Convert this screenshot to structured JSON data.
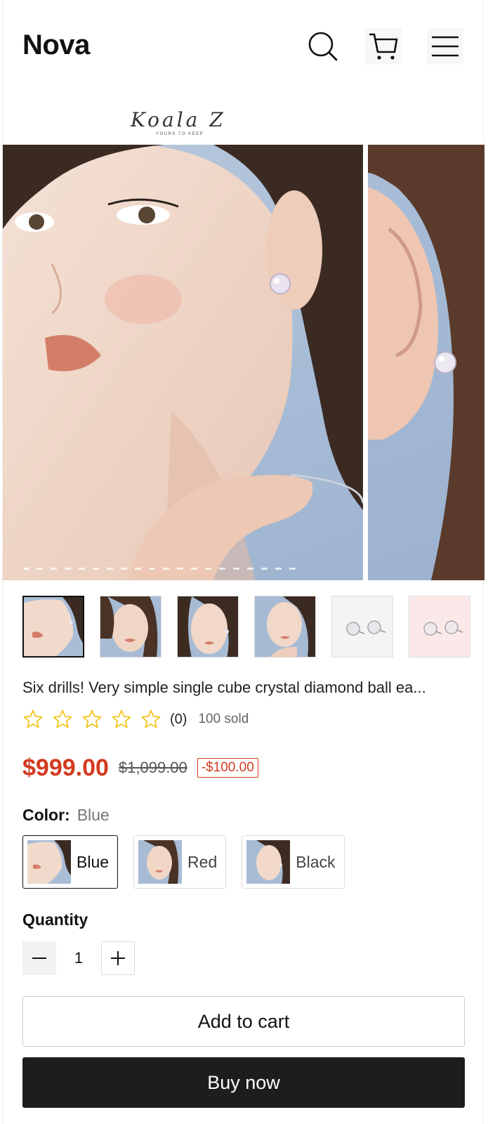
{
  "header": {
    "brand": "Nova",
    "icons": {
      "search": "search-icon",
      "cart": "cart-icon",
      "menu": "menu-icon"
    }
  },
  "product_logo": {
    "name": "Koala Z",
    "tagline": "YOURS TO KEEP"
  },
  "gallery": {
    "slide_count": 20,
    "active_index": 0,
    "thumbnails": [
      "model-side-profile",
      "model-front-view",
      "model-three-quarter",
      "model-looking-up",
      "earrings-pair-white",
      "earrings-pair-pink"
    ],
    "active_thumbnail": 0
  },
  "product": {
    "title": "Six drills! Very simple single cube crystal diamond ball ea...",
    "rating": 0,
    "rating_max": 5,
    "review_count": "(0)",
    "sold": "100 sold",
    "price": "$999.00",
    "compare_price": "$1,099.00",
    "discount": "-$100.00"
  },
  "colors": {
    "primary": "#d33a20",
    "star": "#f0c419",
    "buy_bg": "#1d1d1d"
  },
  "option": {
    "label": "Color:",
    "selected": "Blue",
    "values": [
      {
        "label": "Blue"
      },
      {
        "label": "Red"
      },
      {
        "label": "Black"
      }
    ]
  },
  "quantity": {
    "label": "Quantity",
    "value": "1"
  },
  "actions": {
    "add_to_cart": "Add to cart",
    "buy_now": "Buy now"
  }
}
